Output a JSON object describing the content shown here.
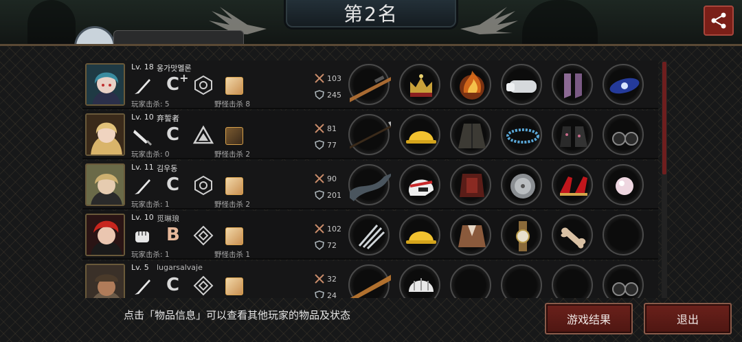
{
  "header": {
    "rank_title": "第2名",
    "share_icon": "share-icon"
  },
  "players": [
    {
      "level": "Lv. 18",
      "name": "옹가맛멜론",
      "grade": "C",
      "grade_plus": "+",
      "player_kills": "玩家击杀: 5",
      "beast_kills": "野怪击杀 8",
      "attack": "103",
      "defense": "245",
      "items": [
        "rifle",
        "crown",
        "flame-armor",
        "gauntlet",
        "boots",
        "galaxy"
      ]
    },
    {
      "level": "Lv. 10",
      "name": "弃誓者",
      "grade": "C",
      "grade_plus": "",
      "player_kills": "玩家击杀: 0",
      "beast_kills": "野怪击杀 2",
      "attack": "81",
      "defense": "77",
      "items": [
        "glaive",
        "hard-hat",
        "coat",
        "bracelet",
        "floral-boots",
        "binoculars"
      ]
    },
    {
      "level": "Lv. 11",
      "name": "김우동",
      "grade": "C",
      "grade_plus": "",
      "player_kills": "玩家击杀: 1",
      "beast_kills": "野怪击杀 2",
      "attack": "90",
      "defense": "201",
      "items": [
        "dragon-weapon",
        "racing-helmet",
        "red-armor",
        "metal-disc",
        "red-heels",
        "pearl"
      ]
    },
    {
      "level": "Lv. 10",
      "name": "觅琳琅",
      "grade": "B",
      "grade_plus": "",
      "player_kills": "玩家击杀: 1",
      "beast_kills": "野怪击杀 1",
      "attack": "102",
      "defense": "72",
      "items": [
        "claws",
        "hard-hat",
        "jacket",
        "watch",
        "bone",
        "empty"
      ]
    },
    {
      "level": "Lv. 5",
      "name": "lugarsalvaje",
      "grade": "C",
      "grade_plus": "",
      "player_kills": "",
      "beast_kills": "",
      "attack": "32",
      "defense": "24",
      "items": [
        "bat",
        "bike-helmet",
        "empty",
        "empty",
        "empty",
        "binoculars"
      ]
    }
  ],
  "footer": {
    "hint": "点击「物品信息」可以查看其他玩家的物品及状态",
    "result_button": "游戏结果",
    "exit_button": "退出"
  }
}
